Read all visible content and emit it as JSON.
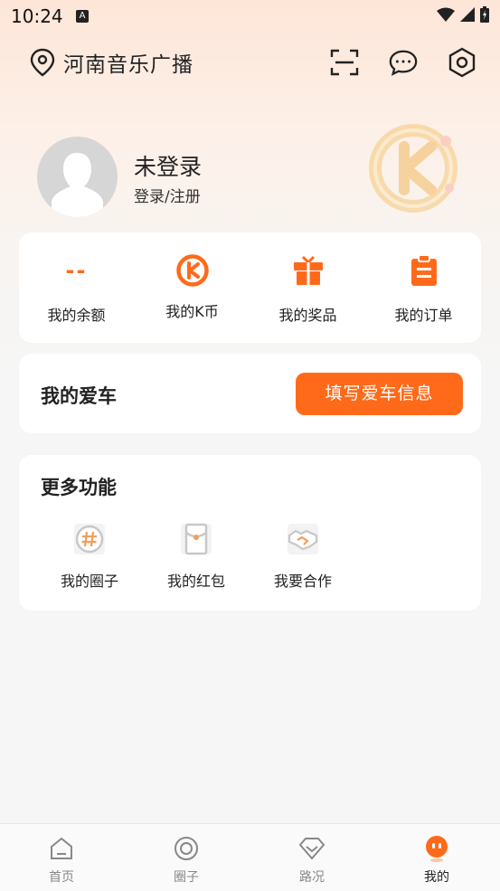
{
  "status_bar": {
    "time": "10:24",
    "notif_letter": "A"
  },
  "header": {
    "location": "河南音乐广播"
  },
  "profile": {
    "name": "未登录",
    "login_link": "登录/注册"
  },
  "stats": [
    {
      "value": "--",
      "label": "我的余额"
    },
    {
      "label": "我的K币"
    },
    {
      "label": "我的奖品"
    },
    {
      "label": "我的订单"
    }
  ],
  "car": {
    "title": "我的爱车",
    "button": "填写爱车信息"
  },
  "more": {
    "title": "更多功能",
    "items": [
      {
        "label": "我的圈子"
      },
      {
        "label": "我的红包"
      },
      {
        "label": "我要合作"
      }
    ]
  },
  "nav": [
    {
      "label": "首页"
    },
    {
      "label": "圈子"
    },
    {
      "label": "路况"
    },
    {
      "label": "我的"
    }
  ],
  "colors": {
    "accent": "#ff6a1a"
  }
}
